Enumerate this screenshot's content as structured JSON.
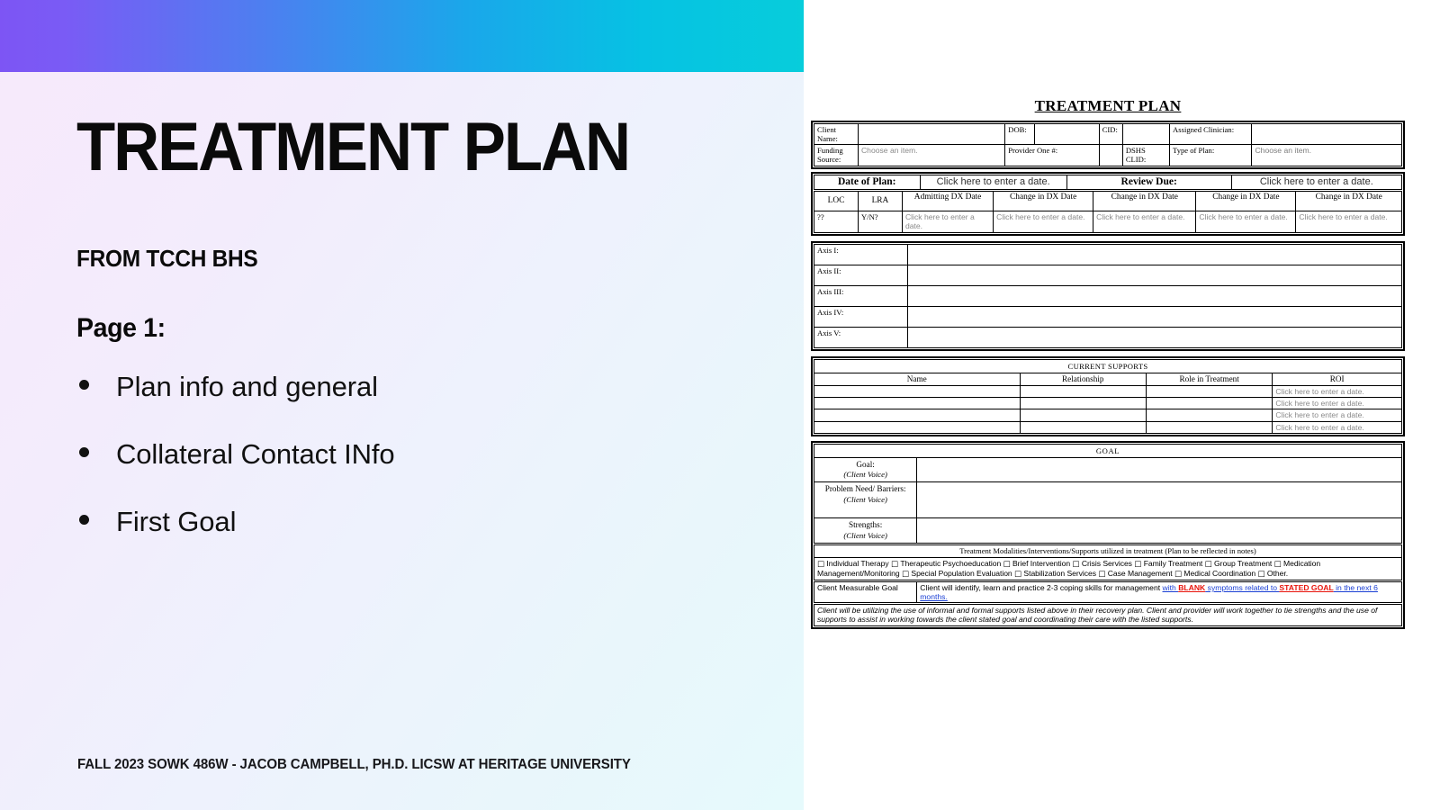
{
  "slide": {
    "title": "TREATMENT PLAN",
    "subtitle": "FROM TCCH BHS",
    "page_label": "Page 1:",
    "bullets": [
      "Plan info and general",
      "Collateral Contact INfo",
      "First Goal"
    ],
    "footer": "FALL 2023 SOWK 486W - JACOB CAMPBELL, PH.D. LICSW AT HERITAGE UNIVERSITY",
    "colors": {
      "gradient_start": "#7d55f4",
      "gradient_mid": "#1aa7ea",
      "gradient_end": "#07cddb",
      "background_tint": "#f2ecfb"
    }
  },
  "document": {
    "title": "TREATMENT PLAN",
    "identity": {
      "client_name_label": "Client Name:",
      "client_name_value": "",
      "dob_label": "DOB:",
      "dob_value": "",
      "cid_label": "CID:",
      "cid_value": "",
      "assigned_clinician_label": "Assigned Clinician:",
      "assigned_clinician_value": "",
      "funding_source_label": "Funding Source:",
      "funding_source_value": "Choose an item.",
      "provider_one_label": "Provider One #:",
      "provider_one_value": "",
      "dshs_clid_label": "DSHS CLID:",
      "dshs_clid_value": "",
      "type_of_plan_label": "Type of Plan:",
      "type_of_plan_value": "Choose an item."
    },
    "dates": {
      "date_of_plan_label": "Date of Plan:",
      "date_of_plan_value": "Click here to enter a date.",
      "review_due_label": "Review Due:",
      "review_due_value": "Click here to enter a date."
    },
    "dx_table": {
      "headers": [
        "LOC",
        "LRA",
        "Admitting DX Date",
        "Change in DX Date",
        "Change in DX Date",
        "Change in DX Date",
        "Change in DX Date"
      ],
      "row": [
        "??",
        "Y/N?",
        "Click here to enter a date.",
        "Click here to enter a date.",
        "Click here to enter a date.",
        "Click here to enter a date.",
        "Click here to enter a date."
      ]
    },
    "axes": [
      {
        "label": "Axis I:",
        "value": ""
      },
      {
        "label": "Axis II:",
        "value": ""
      },
      {
        "label": "Axis III:",
        "value": ""
      },
      {
        "label": "Axis IV:",
        "value": ""
      },
      {
        "label": "Axis V:",
        "value": ""
      }
    ],
    "current_supports": {
      "title": "CURRENT SUPPORTS",
      "headers": [
        "Name",
        "Relationship",
        "Role in Treatment",
        "ROI"
      ],
      "rows": [
        {
          "name": "",
          "relationship": "",
          "role": "",
          "roi": "Click here to enter a date."
        },
        {
          "name": "",
          "relationship": "",
          "role": "",
          "roi": "Click here to enter a date."
        },
        {
          "name": "",
          "relationship": "",
          "role": "",
          "roi": "Click here to enter a date."
        },
        {
          "name": "",
          "relationship": "",
          "role": "",
          "roi": "Click here to enter a date."
        }
      ]
    },
    "goal": {
      "title": "GOAL",
      "rows": [
        {
          "label": "Goal:",
          "sub": "(Client Voice)",
          "value": ""
        },
        {
          "label": "Problem Need/ Barriers:",
          "sub": "(Client Voice)",
          "value": ""
        },
        {
          "label": "Strengths:",
          "sub": "(Client Voice)",
          "value": ""
        }
      ]
    },
    "modalities": {
      "title": "Treatment Modalities/Interventions/Supports utilized in treatment (Plan to be reflected in notes)",
      "options": [
        "Individual Therapy",
        "Therapeutic Psychoeducation",
        "Brief Intervention",
        "Crisis Services",
        "Family Treatment",
        "Group Treatment",
        "Medication Management/Monitoring",
        "Special Population Evaluation",
        "Stabilization Services",
        "Case Management",
        "Medical Coordination",
        "Other."
      ]
    },
    "measurable_goal": {
      "label": "Client Measurable Goal",
      "text_plain_1": "Client will identify, learn and practice 2-3 coping skills for management ",
      "text_link_1": "with ",
      "text_red_1": "BLANK",
      "text_link_2": " symptoms related to ",
      "text_red_2": "STATED GOAL",
      "text_link_3": " in the next 6 months."
    },
    "closing_statement": "Client will be utilizing the use of informal and formal supports listed above in their recovery plan.  Client and provider will work together to tie strengths and the use of supports to assist in working towards the client stated goal and coordinating their care with the listed supports."
  }
}
